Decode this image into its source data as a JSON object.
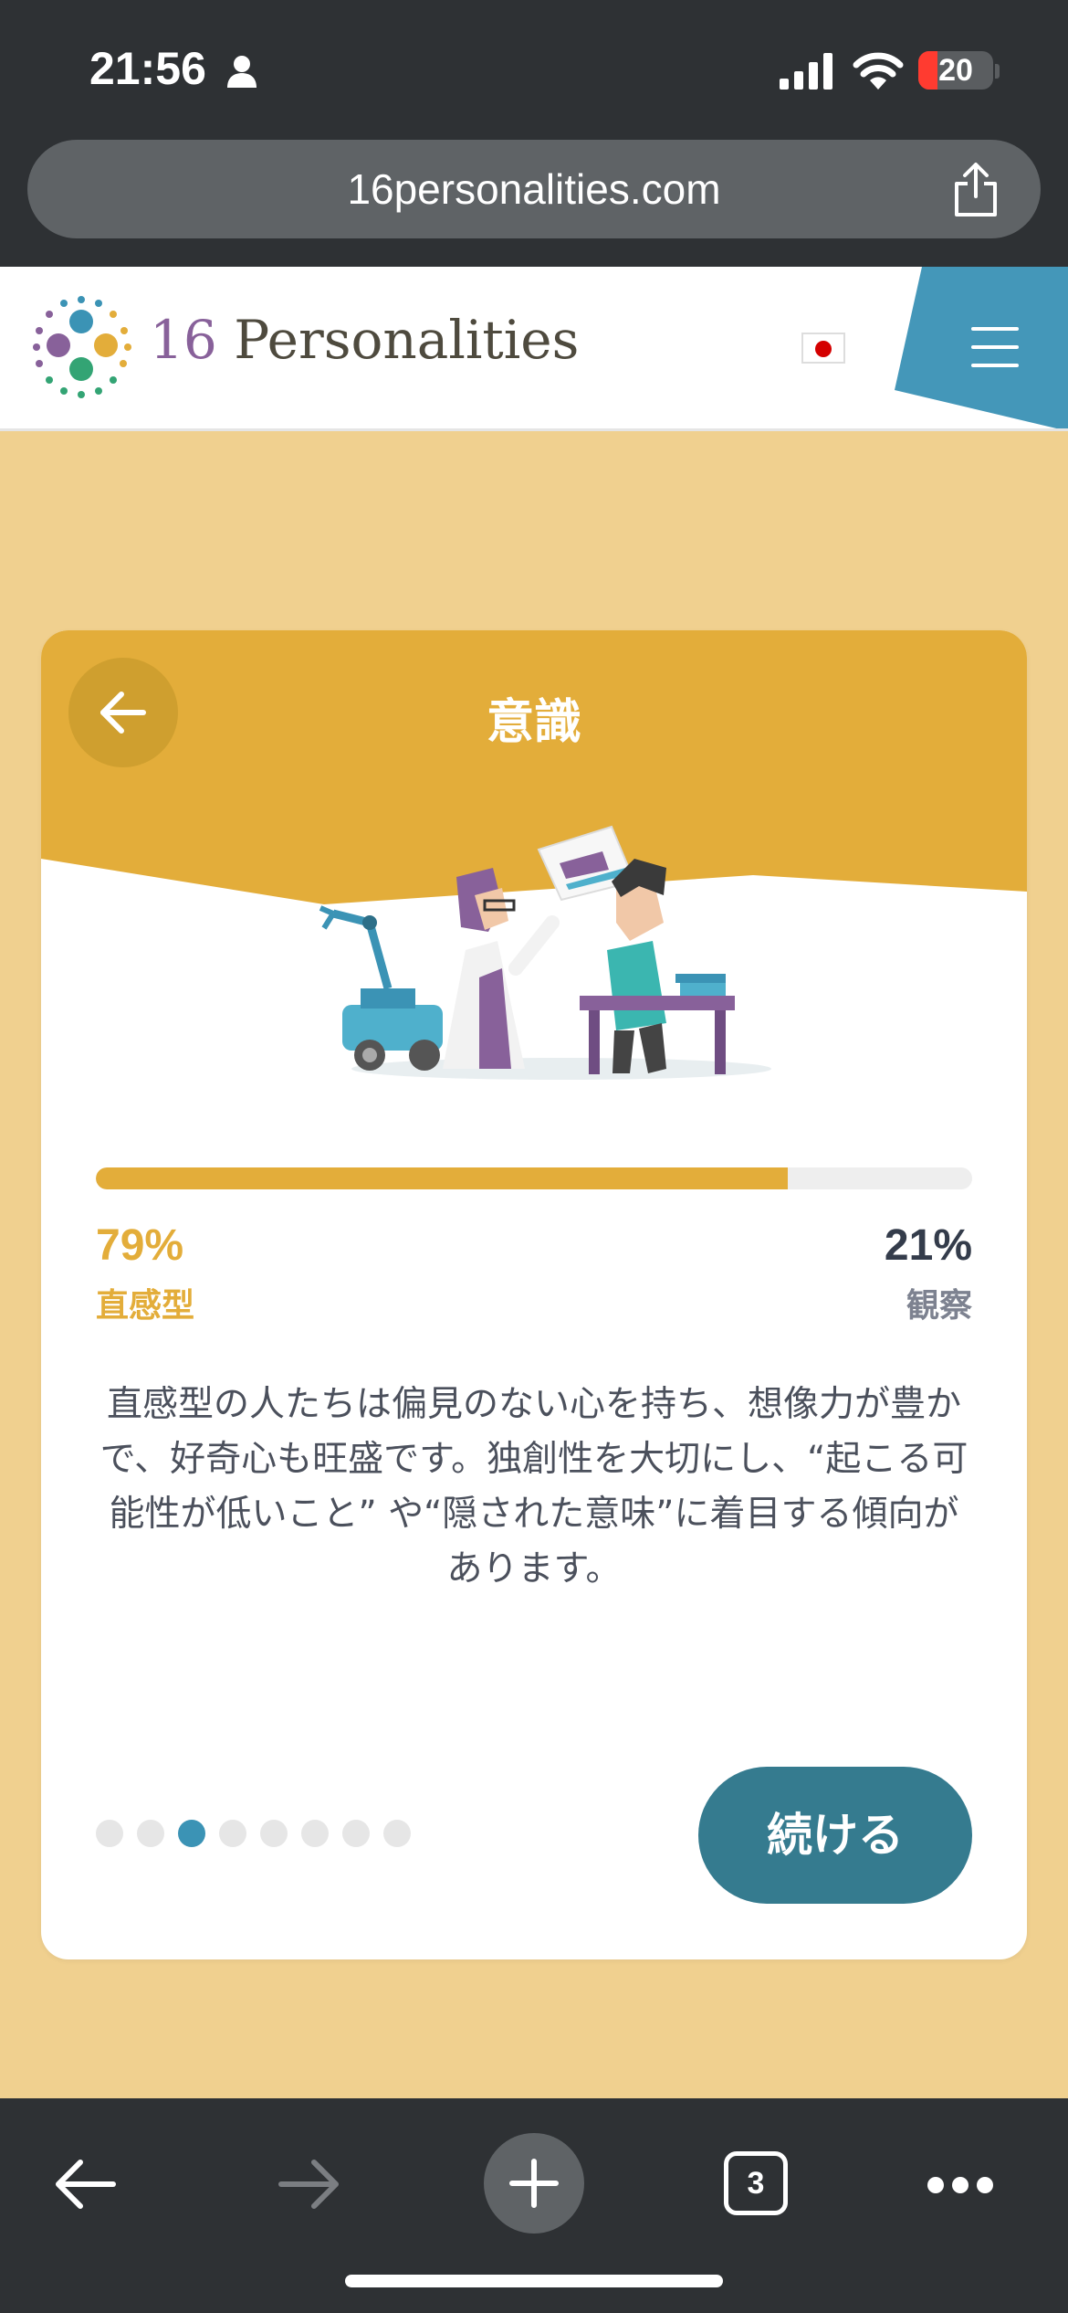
{
  "status_bar": {
    "time": "21:56",
    "battery": "20",
    "icons": [
      "person-icon",
      "cellular-signal-icon",
      "wifi-icon",
      "battery-icon"
    ]
  },
  "browser": {
    "url": "16personalities.com",
    "share_icon": "share-icon"
  },
  "site_header": {
    "logo_number": "16",
    "logo_word": "Personalities",
    "language_flag": "japan-flag-icon",
    "menu_icon": "hamburger-menu-icon",
    "menu_color": "#4497b9"
  },
  "card": {
    "title": "意識",
    "header_color": "#e3ad3a",
    "progress": {
      "fraction": 0.79,
      "left_percent": "79%",
      "left_trait": "直感型",
      "right_percent": "21%",
      "right_trait": "観察"
    },
    "description": "直感型の人たちは偏見のない心を持ち、想像力が豊かで、好奇心も旺盛です。独創性を大切にし、“起こる可能性が低いこと” や“隠された意味”に着目する傾向があります。",
    "pagination": {
      "total": 8,
      "active_index": 2
    },
    "continue_label": "続ける",
    "continue_color": "#357b8f"
  },
  "toolbar": {
    "tab_count": "3",
    "icons": [
      "back-arrow-icon",
      "forward-arrow-icon",
      "plus-icon",
      "tabs-icon",
      "more-icon"
    ]
  }
}
